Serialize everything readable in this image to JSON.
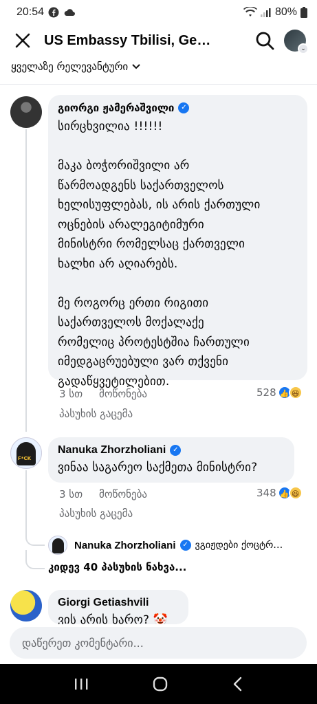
{
  "status_bar": {
    "time": "20:54",
    "battery": "80%"
  },
  "app_bar": {
    "title": "US Embassy Tbilisi, Georgia"
  },
  "sort_label": "ყველაზე რელევანტური",
  "comments": [
    {
      "author": "გიორგი ჟამერაშვილი",
      "verified": true,
      "text": "სირცხვილია !!!!!!\n\nმაკა ბოჭორიშვილი არ\nწარმოადგენს საქართველოს\nხელისუფლებას, ის არის ქართული\nოცნების არალეგიტიმური\nმინისტრი რომელსაც ქართველი\nხალხი არ აღიარებს.\n\nმე როგორც ერთი რიგითი\nსაქართველოს მოქალაქე\nრომელიც პროტესტშია ჩართული\nიმედგაცრუებული ვარ თქვენი\nგადაწყვეტილებით.",
      "time": "3 სთ",
      "like_label": "მოწონება",
      "reply_label": "პასუხის გაცემა",
      "reaction_count": "528"
    },
    {
      "author": "Nanuka Zhorzholiani",
      "verified": true,
      "text": "ვინაა საგარეო საქმეთა მინისტრი?",
      "time": "3 სთ",
      "like_label": "მოწონება",
      "reply_label": "პასუხის გაცემა",
      "reaction_count": "348",
      "nested_reply": {
        "author": "Nanuka Zhorzholiani",
        "preview": "ვგიჟდები ქოცტრ…"
      },
      "more_replies": "კიდევ 40 პასუხის ნახვა..."
    },
    {
      "author": "Giorgi Getiashvili",
      "verified": false,
      "text": "ვის არის ხარო? 🤡"
    }
  ],
  "composer": {
    "placeholder": "დაწერეთ კომენტარი..."
  },
  "colors": {
    "accent": "#1877f2",
    "bubble": "#f0f2f5",
    "muted_text": "#65676b"
  }
}
